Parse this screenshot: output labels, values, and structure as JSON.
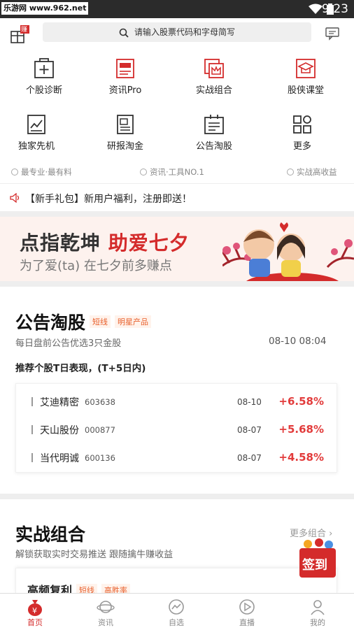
{
  "status_bar": {
    "watermark": "乐游网 www.962.net",
    "time": "9:23"
  },
  "search": {
    "placeholder": "请输入股票代码和字母简写"
  },
  "gift_badge": "赚",
  "grid": [
    {
      "label": "个股诊断",
      "icon": "plus-box-icon"
    },
    {
      "label": "资讯Pro",
      "icon": "pro-icon"
    },
    {
      "label": "实战组合",
      "icon": "crown-stack-icon"
    },
    {
      "label": "股侠课堂",
      "icon": "graduation-cap-icon"
    },
    {
      "label": "独家先机",
      "icon": "trend-chart-icon"
    },
    {
      "label": "研报淘金",
      "icon": "report-icon"
    },
    {
      "label": "公告淘股",
      "icon": "announcement-icon"
    },
    {
      "label": "更多",
      "icon": "more-grid-icon"
    }
  ],
  "slogans": [
    "最专业·最有料",
    "资讯·工具NO.1",
    "实战高收益"
  ],
  "notice": "【新手礼包】新用户福利，注册即送！",
  "banner": {
    "title_a": "点指乾坤",
    "title_b": "助爱七夕",
    "subtitle": "为了爱(ta)  在七夕前多赚点"
  },
  "announcement": {
    "title": "公告淘股",
    "tags": [
      "短线",
      "明星产品"
    ],
    "desc": "每日盘前公告优选3只金股",
    "datetime": "08-10 08:04",
    "heading": "推荐个股T日表现，(T+5日内)",
    "rows": [
      {
        "name": "艾迪精密",
        "code": "603638",
        "date": "08-10",
        "change": "+6.58%"
      },
      {
        "name": "天山股份",
        "code": "000877",
        "date": "08-07",
        "change": "+5.68%"
      },
      {
        "name": "当代明诚",
        "code": "600136",
        "date": "08-07",
        "change": "+4.58%"
      }
    ]
  },
  "portfolio": {
    "title": "实战组合",
    "more": "更多组合",
    "desc": "解锁获取实时交易推送  跟随擒牛赚收益",
    "item_title": "高频复利",
    "item_tags": [
      "短线",
      "高胜率"
    ],
    "checkin": "签到"
  },
  "tabs": [
    {
      "label": "首页",
      "active": true
    },
    {
      "label": "资讯"
    },
    {
      "label": "自选"
    },
    {
      "label": "直播"
    },
    {
      "label": "我的"
    }
  ],
  "colors": {
    "brand_red": "#d42b2b",
    "tag_orange": "#e8602c",
    "rise_red": "#e23b3b"
  }
}
